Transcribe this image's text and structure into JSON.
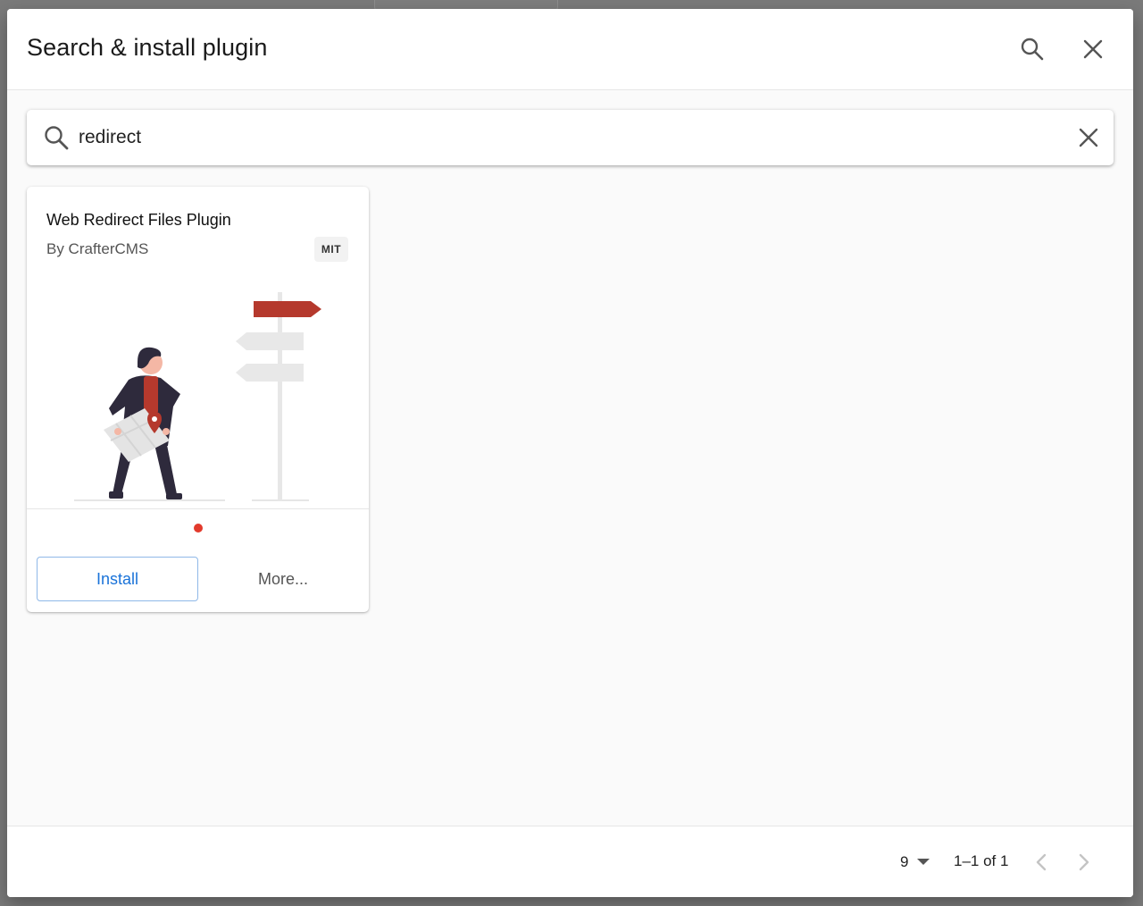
{
  "dialog": {
    "title": "Search & install plugin"
  },
  "search": {
    "value": "redirect",
    "placeholder": "Search"
  },
  "plugins": [
    {
      "name": "Web Redirect Files Plugin",
      "author": "By CrafterCMS",
      "license": "MIT",
      "install_label": "Install",
      "more_label": "More..."
    }
  ],
  "pagination": {
    "rows_per_page": "9",
    "range_label": "1–1 of 1"
  },
  "colors": {
    "accent": "#1a73d9",
    "dot": "#e23a2c",
    "sign": "#b5392d"
  },
  "icons": {
    "header_search": "search-icon",
    "header_close": "close-icon",
    "search_field": "search-icon",
    "clear": "close-icon",
    "dropdown": "caret-down-icon",
    "prev": "chevron-left-icon",
    "next": "chevron-right-icon"
  }
}
